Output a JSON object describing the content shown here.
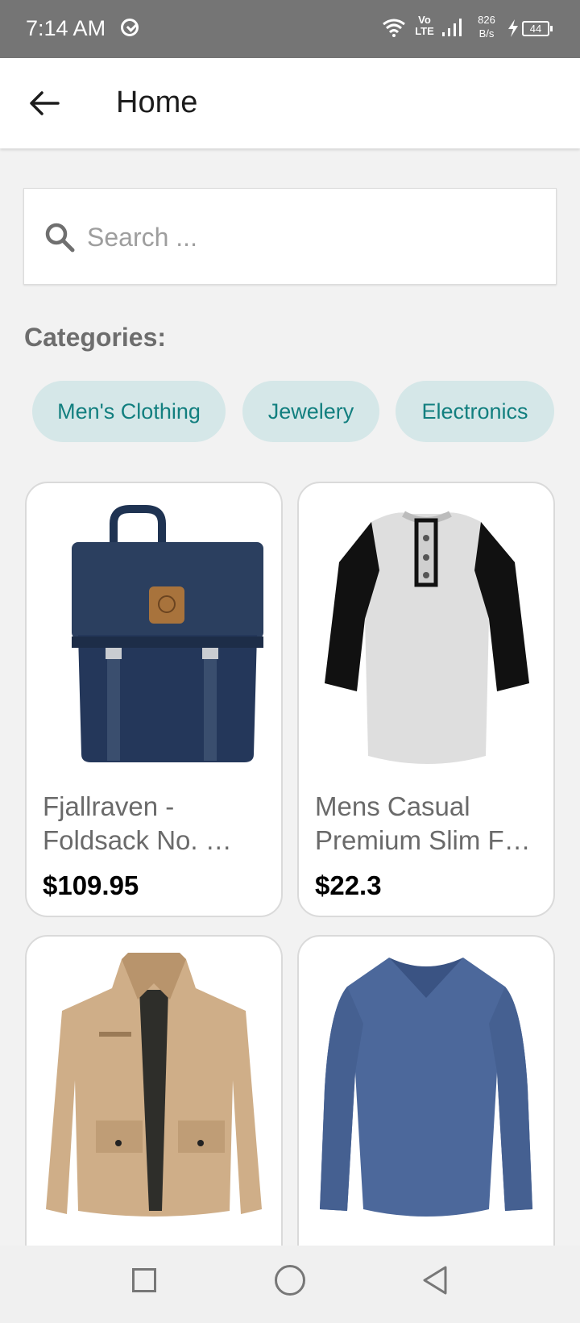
{
  "status_bar": {
    "time": "7:14 AM",
    "volte": "Vo\nLTE",
    "speed_value": "826",
    "speed_unit": "B/s",
    "battery": "44",
    "icons": [
      "sync-icon",
      "wifi-icon",
      "signal-icon",
      "charging-bolt-icon",
      "battery-icon"
    ]
  },
  "app_bar": {
    "title": "Home",
    "back_icon": "arrow-left-icon"
  },
  "search": {
    "placeholder": "Search ...",
    "value": "",
    "icon": "search-icon"
  },
  "categories": {
    "label": "Categories:",
    "items": [
      "Men's Clothing",
      "Jewelery",
      "Electronics"
    ]
  },
  "products": [
    {
      "title_line1": "Fjallraven -",
      "title_line2": "Foldsack No. …",
      "price": "$109.95",
      "image": "navy-backpack"
    },
    {
      "title_line1": "Mens Casual",
      "title_line2": "Premium Slim F…",
      "price": "$22.3",
      "image": "raglan-henley-shirt"
    },
    {
      "title_line1": "",
      "title_line2": "",
      "price": "",
      "image": "khaki-jacket"
    },
    {
      "title_line1": "",
      "title_line2": "",
      "price": "",
      "image": "blue-long-sleeve-shirt"
    }
  ],
  "nav_bar": {
    "icons": [
      "square-recents-icon",
      "circle-home-icon",
      "triangle-back-icon"
    ]
  },
  "colors": {
    "status_bar": "#757575",
    "chip_bg": "#d5e7e8",
    "chip_text": "#127f7f",
    "background": "#f2f2f2"
  }
}
